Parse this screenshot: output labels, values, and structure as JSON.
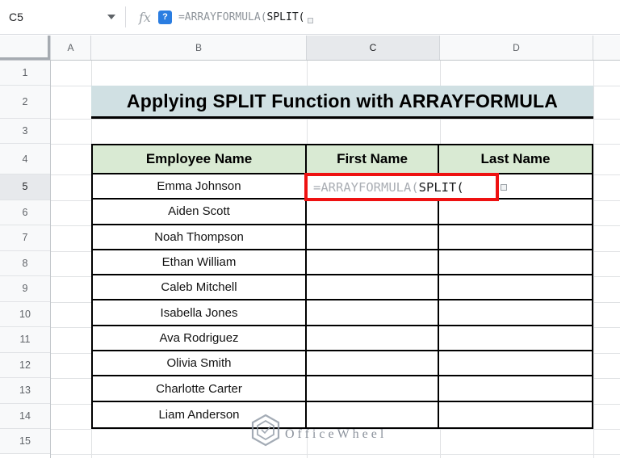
{
  "formula_bar": {
    "cell_reference": "C5",
    "fx_label": "fx",
    "help_badge": "?",
    "formula": {
      "dim_part": "=ARRAYFORMULA(",
      "active_part": "SPLIT("
    }
  },
  "column_headers": {
    "a": "A",
    "b": "B",
    "c": "C",
    "d": "D"
  },
  "selected_column": "C",
  "row_numbers": [
    "1",
    "2",
    "3",
    "4",
    "5",
    "6",
    "7",
    "8",
    "9",
    "10",
    "11",
    "12",
    "13",
    "14",
    "15"
  ],
  "selected_row": "5",
  "title_banner": "Applying SPLIT Function with ARRAYFORMULA",
  "table": {
    "headers": [
      "Employee Name",
      "First Name",
      "Last Name"
    ],
    "employees": [
      "Emma Johnson",
      "Aiden Scott",
      "Noah Thompson",
      "Ethan William",
      "Caleb Mitchell",
      "Isabella Jones",
      "Ava Rodriguez",
      "Olivia Smith",
      "Charlotte Carter",
      "Liam Anderson"
    ]
  },
  "cell_editor": {
    "dim_part": "=ARRAYFORMULA(",
    "active_part": "SPLIT("
  },
  "watermark": "OfficeWheel",
  "colors": {
    "table_header_fill": "#d9ead3",
    "title_fill": "#d0e0e3",
    "annotation_red": "#ee1111",
    "selected_header_fill": "#e7e9ec",
    "help_badge_blue": "#2a7de1"
  }
}
